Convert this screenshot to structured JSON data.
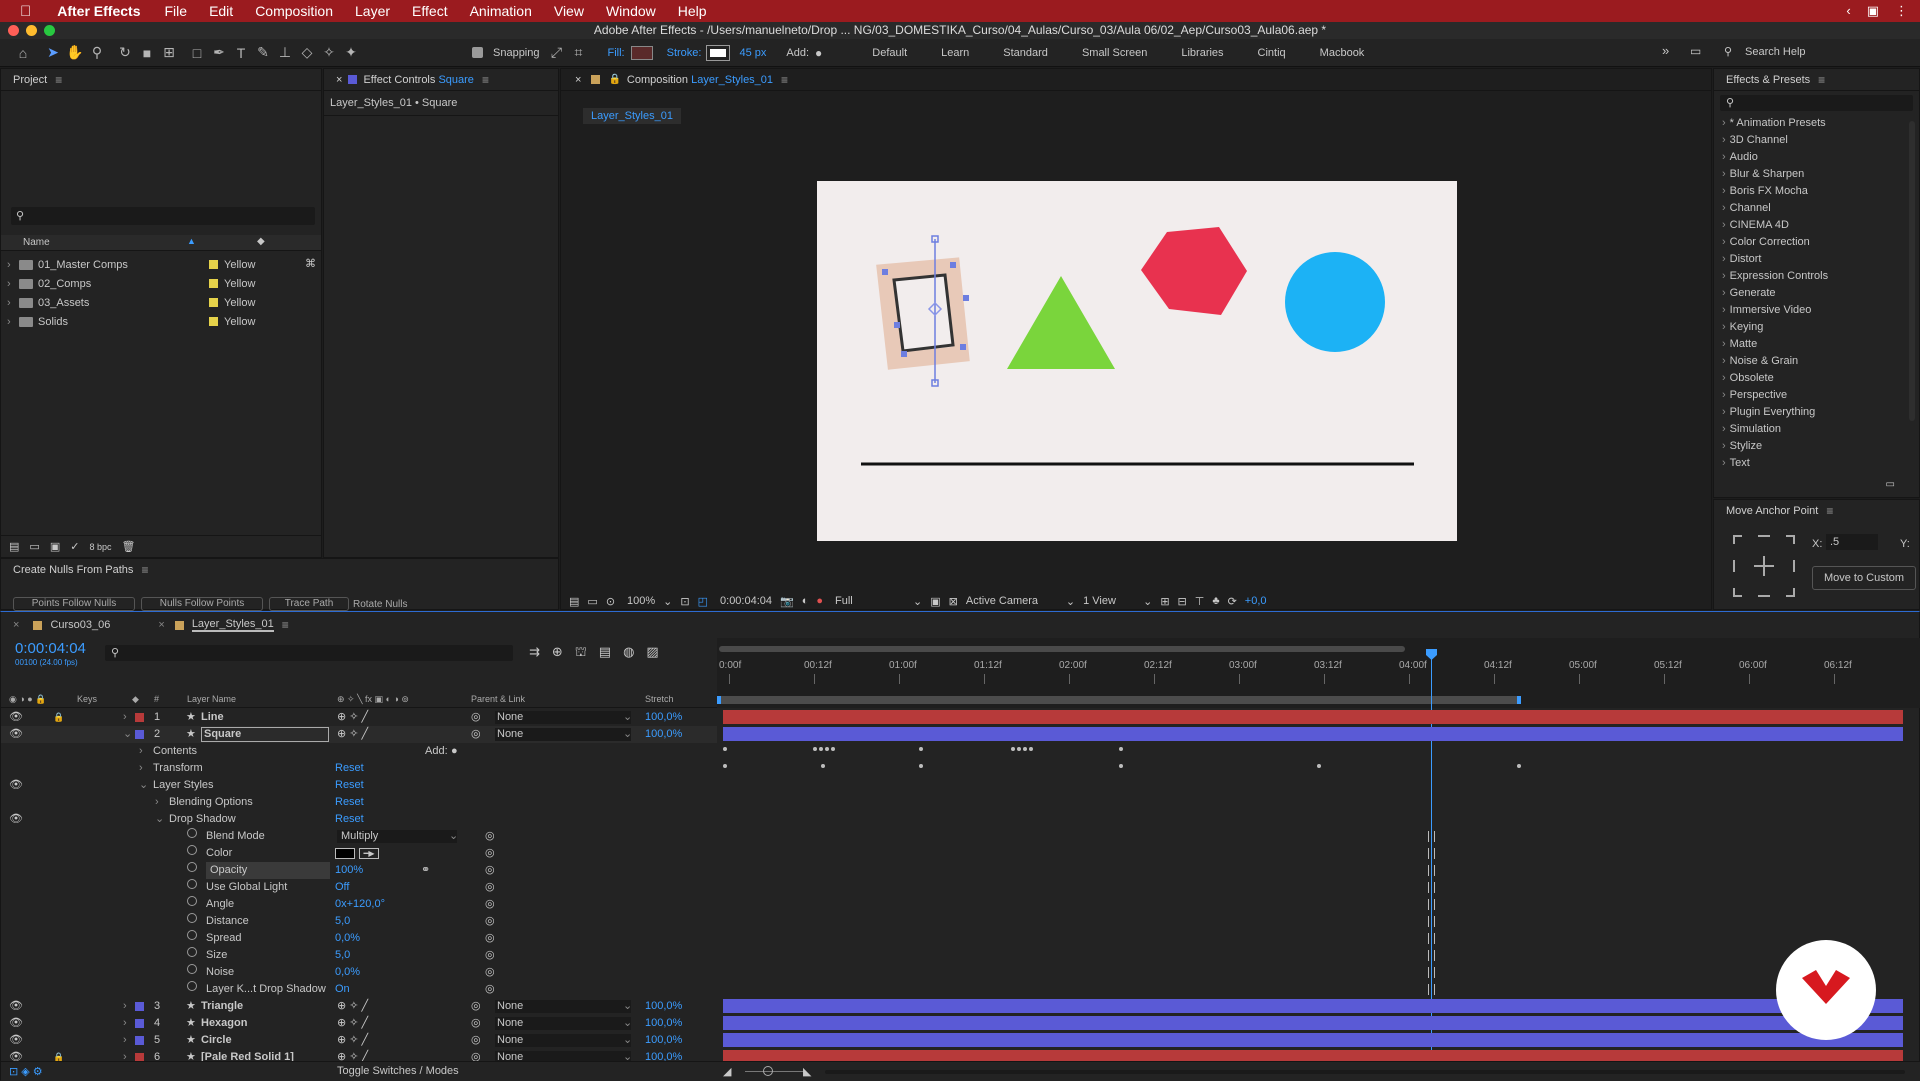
{
  "menubar": {
    "app_name": "After Effects",
    "items": [
      "File",
      "Edit",
      "Composition",
      "Layer",
      "Effect",
      "Animation",
      "View",
      "Window",
      "Help"
    ]
  },
  "window_title": "Adobe After Effects - /Users/manuelneto/Drop ... NG/03_DOMESTIKA_Curso/04_Aulas/Curso_03/Aula 06/02_Aep/Curso03_Aula06.aep *",
  "toolbar": {
    "snapping": "Snapping",
    "fill": "Fill:",
    "stroke": "Stroke:",
    "stroke_width": "45 px",
    "add": "Add:",
    "workspaces": [
      "Default",
      "Learn",
      "Standard",
      "Small Screen",
      "Libraries",
      "Cintiq",
      "Macbook"
    ],
    "search_help": "Search Help"
  },
  "project": {
    "title": "Project",
    "col_name": "Name",
    "items": [
      {
        "name": "01_Master Comps",
        "label": "Yellow"
      },
      {
        "name": "02_Comps",
        "label": "Yellow"
      },
      {
        "name": "03_Assets",
        "label": "Yellow"
      },
      {
        "name": "Solids",
        "label": "Yellow"
      }
    ],
    "bpc": "8 bpc"
  },
  "effect_controls": {
    "title": "Effect Controls",
    "target": "Square",
    "subtitle": "Layer_Styles_01 • Square"
  },
  "create_nulls": {
    "title": "Create Nulls From Paths",
    "btn1": "Points Follow Nulls",
    "btn2": "Nulls Follow Points",
    "btn3": "Trace Path",
    "rotate": "Rotate Nulls"
  },
  "composition": {
    "title": "Composition",
    "name": "Layer_Styles_01",
    "tab": "Layer_Styles_01",
    "zoom": "100%",
    "timecode": "0:00:04:04",
    "resolution": "Full",
    "camera": "Active Camera",
    "view": "1 View",
    "exposure": "+0,0"
  },
  "effects_presets": {
    "title": "Effects & Presets",
    "items": [
      "* Animation Presets",
      "3D Channel",
      "Audio",
      "Blur & Sharpen",
      "Boris FX Mocha",
      "Channel",
      "CINEMA 4D",
      "Color Correction",
      "Distort",
      "Expression Controls",
      "Generate",
      "Immersive Video",
      "Keying",
      "Matte",
      "Noise & Grain",
      "Obsolete",
      "Perspective",
      "Plugin Everything",
      "Simulation",
      "Stylize",
      "Text"
    ]
  },
  "anchor": {
    "title": "Move Anchor Point",
    "x_label": "X:",
    "x_value": ".5",
    "y_label": "Y:",
    "button": "Move to Custom"
  },
  "timeline": {
    "tabs": [
      "Curso03_06",
      "Layer_Styles_01"
    ],
    "timecode": "0:00:04:04",
    "fps": "00100 (24.00 fps)",
    "headers": {
      "keys": "Keys",
      "num": "#",
      "layer_name": "Layer Name",
      "parent": "Parent & Link",
      "stretch": "Stretch"
    },
    "ruler": [
      "0:00f",
      "00:12f",
      "01:00f",
      "01:12f",
      "02:00f",
      "02:12f",
      "03:00f",
      "03:12f",
      "04:00f",
      "04:12f",
      "05:00f",
      "05:12f",
      "06:00f",
      "06:12f"
    ],
    "layers_top": [
      {
        "num": "1",
        "name": "Line",
        "parent": "None",
        "stretch": "100,0%",
        "color": "#b73a3a"
      },
      {
        "num": "2",
        "name": "Square",
        "parent": "None",
        "stretch": "100,0%",
        "color": "#5a5ad6"
      }
    ],
    "props": {
      "contents": "Contents",
      "add": "Add:",
      "transform": "Transform",
      "reset": "Reset",
      "layer_styles": "Layer Styles",
      "blending": "Blending Options",
      "drop_shadow": "Drop Shadow"
    },
    "shadow_props": [
      {
        "name": "Blend Mode",
        "value": "Multiply"
      },
      {
        "name": "Color",
        "value": ""
      },
      {
        "name": "Opacity",
        "value": "100%"
      },
      {
        "name": "Use Global Light",
        "value": "Off"
      },
      {
        "name": "Angle",
        "value": "0x+120,0°"
      },
      {
        "name": "Distance",
        "value": "5,0"
      },
      {
        "name": "Spread",
        "value": "0,0%"
      },
      {
        "name": "Size",
        "value": "5,0"
      },
      {
        "name": "Noise",
        "value": "0,0%"
      },
      {
        "name": "Layer K...t Drop Shadow",
        "value": "On"
      }
    ],
    "layers_bottom": [
      {
        "num": "3",
        "name": "Triangle",
        "parent": "None",
        "stretch": "100,0%",
        "color": "#5a5ad6"
      },
      {
        "num": "4",
        "name": "Hexagon",
        "parent": "None",
        "stretch": "100,0%",
        "color": "#5a5ad6"
      },
      {
        "num": "5",
        "name": "Circle",
        "parent": "None",
        "stretch": "100,0%",
        "color": "#5a5ad6"
      },
      {
        "num": "6",
        "name": "[Pale Red Solid 1]",
        "parent": "None",
        "stretch": "100,0%",
        "color": "#b73a3a"
      }
    ],
    "toggle": "Toggle Switches / Modes"
  }
}
